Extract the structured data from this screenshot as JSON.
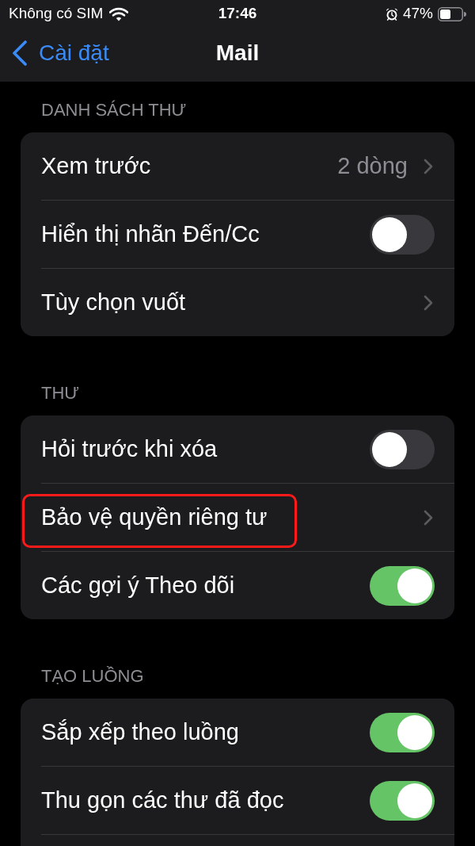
{
  "status_bar": {
    "carrier": "Không có SIM",
    "time": "17:46",
    "battery": "47%"
  },
  "nav_bar": {
    "back": "Cài đặt",
    "title": "Mail"
  },
  "sections": [
    {
      "header": "DANH SÁCH THƯ",
      "items": [
        {
          "kind": "link",
          "label": "Xem trước",
          "value": "2 dòng",
          "highlighted": false
        },
        {
          "kind": "toggle",
          "label": "Hiển thị nhãn Đến/Cc",
          "on": false,
          "highlighted": false
        },
        {
          "kind": "link",
          "label": "Tùy chọn vuốt",
          "highlighted": false
        }
      ]
    },
    {
      "header": "THƯ",
      "items": [
        {
          "kind": "toggle",
          "label": "Hỏi trước khi xóa",
          "on": false,
          "highlighted": false
        },
        {
          "kind": "link",
          "label": "Bảo vệ quyền riêng tư",
          "highlighted": true
        },
        {
          "kind": "toggle",
          "label": "Các gợi ý Theo dõi",
          "on": true,
          "highlighted": false
        }
      ]
    },
    {
      "header": "TẠO LUỒNG",
      "items": [
        {
          "kind": "toggle",
          "label": "Sắp xếp theo luồng",
          "on": true,
          "highlighted": false
        },
        {
          "kind": "toggle",
          "label": "Thu gọn các thư đã đọc",
          "on": true,
          "highlighted": false
        }
      ]
    }
  ]
}
